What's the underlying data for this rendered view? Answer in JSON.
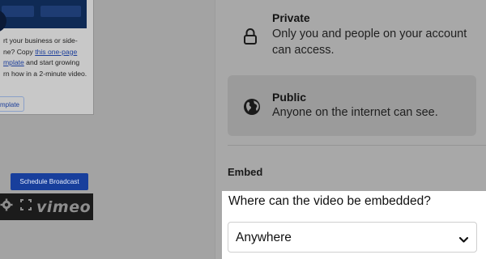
{
  "left_panel": {
    "card": {
      "description_before_link": "rt your business or side-ne? Copy ",
      "link_text": "this one-page mplate",
      "description_after_link": " and start growing rn how in a 2-minute video.",
      "button_label": "mplate"
    },
    "schedule_button_label": "Schedule Broadcast",
    "player": {
      "settings_icon": "gear-icon",
      "fullscreen_icon": "fullscreen-icon",
      "brand_logo_text": "vimeo"
    }
  },
  "privacy": {
    "options": [
      {
        "title": "Private",
        "description": "Only you and people on your account can access.",
        "icon": "lock-icon",
        "selected": false
      },
      {
        "title": "Public",
        "description": "Anyone on the internet can see.",
        "icon": "globe-icon",
        "selected": true
      }
    ]
  },
  "embed": {
    "heading": "Embed",
    "question": "Where can the video be embedded?",
    "select": {
      "value": "Anywhere",
      "icon": "chevron-down-icon"
    }
  },
  "colors": {
    "overlay_gray": "#a8a8a8",
    "selected_option_bg": "#9b9b9b",
    "highlight_panel": "#ffffff",
    "button_blue": "#183f9c",
    "player_bar": "#1b1b1b"
  }
}
